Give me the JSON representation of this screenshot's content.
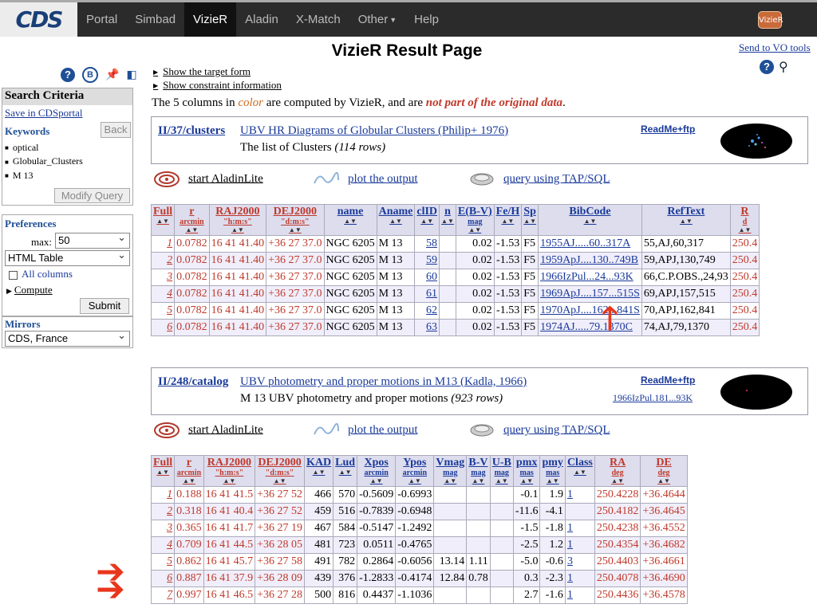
{
  "nav": {
    "logo": "CDS",
    "items": [
      "Portal",
      "Simbad",
      "VizieR",
      "Aladin",
      "X-Match",
      "Other",
      "Help"
    ],
    "active": "VizieR",
    "icon_label": "VizieR"
  },
  "page": {
    "title": "VizieR Result Page",
    "send_vo": "Send to VO tools",
    "show_target": "Show the target form",
    "show_constraint": "Show constraint information",
    "note_prefix": "The 5 columns in ",
    "note_color": "color",
    "note_mid": " are computed by VizieR, and are ",
    "note_notpart": "not part of the original data",
    "note_end": "."
  },
  "left": {
    "icon_b": "B",
    "search_title": "Search Criteria",
    "save": "Save in CDSportal",
    "keywords_label": "Keywords",
    "back": "Back",
    "keywords": [
      "optical",
      "Globular_Clusters",
      "M 13"
    ],
    "modify": "Modify Query",
    "prefs_label": "Preferences",
    "max_label": "max:",
    "max_value": "50",
    "format_value": "HTML Table",
    "all_columns": "All columns",
    "compute": "Compute",
    "submit": "Submit",
    "mirrors_label": "Mirrors",
    "mirror_value": "CDS, France"
  },
  "actions": {
    "aladin": "start AladinLite",
    "plot": "plot the output",
    "tap": "query using TAP/SQL"
  },
  "cat1": {
    "id": "II/37/clusters",
    "title": "UBV HR Diagrams of Globular Clusters (Philip+ 1976)",
    "subtitle": "The list of Clusters ",
    "rows_note": "(114 rows)",
    "readme": "ReadMe+ftp"
  },
  "cat2": {
    "id": "II/248/catalog",
    "title": "UBV photometry and proper motions in M13 (Kadla, 1966)",
    "subtitle": "M 13 UBV photometry and proper motions ",
    "rows_note": "(923 rows)",
    "readme": "ReadMe+ftp",
    "bibcode": "1966IzPul.181...93K"
  },
  "table1": {
    "headers": [
      {
        "label": "Full",
        "unit": "",
        "computed": true
      },
      {
        "label": "r",
        "unit": "arcmin",
        "computed": true
      },
      {
        "label": "RAJ2000",
        "unit": "\"h:m:s\"",
        "computed": true
      },
      {
        "label": "DEJ2000",
        "unit": "\"d:m:s\"",
        "computed": true
      },
      {
        "label": "name",
        "unit": "",
        "computed": false
      },
      {
        "label": "Aname",
        "unit": "",
        "computed": false
      },
      {
        "label": "clID",
        "unit": "",
        "computed": false
      },
      {
        "label": "n",
        "unit": "",
        "computed": false
      },
      {
        "label": "E(B-V)",
        "unit": "mag",
        "computed": false
      },
      {
        "label": "Fe/H",
        "unit": "",
        "computed": false
      },
      {
        "label": "Sp",
        "unit": "",
        "computed": false
      },
      {
        "label": "BibCode",
        "unit": "",
        "computed": false
      },
      {
        "label": "RefText",
        "unit": "",
        "computed": false
      },
      {
        "label": "R",
        "unit": "d",
        "computed": true
      }
    ],
    "rows": [
      [
        "1",
        "0.0782",
        "16 41 41.40",
        "+36 27 37.0",
        "NGC 6205",
        "M 13",
        "58",
        "",
        "0.02",
        "-1.53",
        "F5",
        "1955AJ.....60..317A",
        "55,AJ,60,317",
        "250.4"
      ],
      [
        "2",
        "0.0782",
        "16 41 41.40",
        "+36 27 37.0",
        "NGC 6205",
        "M 13",
        "59",
        "",
        "0.02",
        "-1.53",
        "F5",
        "1959ApJ....130..749B",
        "59,APJ,130,749",
        "250.4"
      ],
      [
        "3",
        "0.0782",
        "16 41 41.40",
        "+36 27 37.0",
        "NGC 6205",
        "M 13",
        "60",
        "",
        "0.02",
        "-1.53",
        "F5",
        "1966IzPul...24...93K",
        "66,C.P.OBS.,24,93",
        "250.4"
      ],
      [
        "4",
        "0.0782",
        "16 41 41.40",
        "+36 27 37.0",
        "NGC 6205",
        "M 13",
        "61",
        "",
        "0.02",
        "-1.53",
        "F5",
        "1969ApJ....157...515S",
        "69,APJ,157,515",
        "250.4"
      ],
      [
        "5",
        "0.0782",
        "16 41 41.40",
        "+36 27 37.0",
        "NGC 6205",
        "M 13",
        "62",
        "",
        "0.02",
        "-1.53",
        "F5",
        "1970ApJ....162...841S",
        "70,APJ,162,841",
        "250.4"
      ],
      [
        "6",
        "0.0782",
        "16 41 41.40",
        "+36 27 37.0",
        "NGC 6205",
        "M 13",
        "63",
        "",
        "0.02",
        "-1.53",
        "F5",
        "1974AJ.....79.1370C",
        "74,AJ,79,1370",
        "250.4"
      ]
    ]
  },
  "table2": {
    "headers": [
      {
        "label": "Full",
        "unit": "",
        "computed": true
      },
      {
        "label": "r",
        "unit": "arcmin",
        "computed": true
      },
      {
        "label": "RAJ2000",
        "unit": "\"h:m:s\"",
        "computed": true
      },
      {
        "label": "DEJ2000",
        "unit": "\"d:m:s\"",
        "computed": true
      },
      {
        "label": "KAD",
        "unit": "",
        "computed": false
      },
      {
        "label": "Lud",
        "unit": "",
        "computed": false
      },
      {
        "label": "Xpos",
        "unit": "arcmin",
        "computed": false
      },
      {
        "label": "Ypos",
        "unit": "arcmin",
        "computed": false
      },
      {
        "label": "Vmag",
        "unit": "mag",
        "computed": false
      },
      {
        "label": "B-V",
        "unit": "mag",
        "computed": false
      },
      {
        "label": "U-B",
        "unit": "mag",
        "computed": false
      },
      {
        "label": "pmx",
        "unit": "mas",
        "computed": false
      },
      {
        "label": "pmy",
        "unit": "mas",
        "computed": false
      },
      {
        "label": "Class",
        "unit": "",
        "computed": false
      },
      {
        "label": "RA",
        "unit": "deg",
        "computed": true
      },
      {
        "label": "DE",
        "unit": "deg",
        "computed": true
      }
    ],
    "rows": [
      [
        "1",
        "0.188",
        "16 41 41.5",
        "+36 27 52",
        "466",
        "570",
        "-0.5609",
        "-0.6993",
        "",
        "",
        "",
        "-0.1",
        "1.9",
        "1",
        "250.4228",
        "+36.4644"
      ],
      [
        "2",
        "0.318",
        "16 41 40.4",
        "+36 27 52",
        "459",
        "516",
        "-0.7839",
        "-0.6948",
        "",
        "",
        "",
        "-11.6",
        "-4.1",
        "",
        "250.4182",
        "+36.4645"
      ],
      [
        "3",
        "0.365",
        "16 41 41.7",
        "+36 27 19",
        "467",
        "584",
        "-0.5147",
        "-1.2492",
        "",
        "",
        "",
        "-1.5",
        "-1.8",
        "1",
        "250.4238",
        "+36.4552"
      ],
      [
        "4",
        "0.709",
        "16 41 44.5",
        "+36 28 05",
        "481",
        "723",
        "0.0511",
        "-0.4765",
        "",
        "",
        "",
        "-2.5",
        "1.2",
        "1",
        "250.4354",
        "+36.4682"
      ],
      [
        "5",
        "0.862",
        "16 41 45.7",
        "+36 27 58",
        "491",
        "782",
        "0.2864",
        "-0.6056",
        "13.14",
        "1.11",
        "",
        "-5.0",
        "-0.6",
        "3",
        "250.4403",
        "+36.4661"
      ],
      [
        "6",
        "0.887",
        "16 41 37.9",
        "+36 28 09",
        "439",
        "376",
        "-1.2833",
        "-0.4174",
        "12.84",
        "0.78",
        "",
        "0.3",
        "-2.3",
        "1",
        "250.4078",
        "+36.4690"
      ],
      [
        "7",
        "0.997",
        "16 41 46.5",
        "+36 27 28",
        "500",
        "816",
        "0.4437",
        "-1.1036",
        "",
        "",
        "",
        "2.7",
        "-1.6",
        "1",
        "250.4436",
        "+36.4578"
      ]
    ]
  },
  "colors": {
    "computed": "#c0392b",
    "link": "#1a3a9a",
    "arrow": "#e8361c"
  },
  "icons": {
    "help": "help-icon",
    "sort": "sort-triangle-icon",
    "aladin": "aladin-galaxy-icon",
    "plot": "plot-wave-icon",
    "tap": "tap-database-icon",
    "arrow": "red-arrow-icon"
  }
}
